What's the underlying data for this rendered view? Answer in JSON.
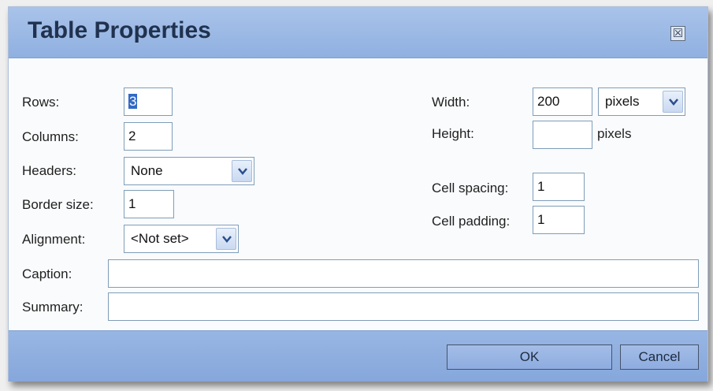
{
  "dialog": {
    "title": "Table Properties",
    "close_label": "☒"
  },
  "fields": {
    "rows": {
      "label": "Rows:",
      "value": "3"
    },
    "columns": {
      "label": "Columns:",
      "value": "2"
    },
    "headers": {
      "label": "Headers:",
      "value": "None"
    },
    "border_size": {
      "label": "Border size:",
      "value": "1"
    },
    "alignment": {
      "label": "Alignment:",
      "value": "<Not set>"
    },
    "width": {
      "label": "Width:",
      "value": "200",
      "unit": "pixels"
    },
    "height": {
      "label": "Height:",
      "value": "",
      "unit": "pixels"
    },
    "cell_spacing": {
      "label": "Cell spacing:",
      "value": "1"
    },
    "cell_padding": {
      "label": "Cell padding:",
      "value": "1"
    },
    "caption": {
      "label": "Caption:",
      "value": ""
    },
    "summary": {
      "label": "Summary:",
      "value": ""
    }
  },
  "buttons": {
    "ok": "OK",
    "cancel": "Cancel"
  },
  "colors": {
    "titlebar": "#a9c3ea",
    "footer": "#8fb0e0",
    "selection": "#316ac5"
  },
  "icons": {
    "close": "close-icon",
    "dropdown": "chevron-down-icon"
  }
}
